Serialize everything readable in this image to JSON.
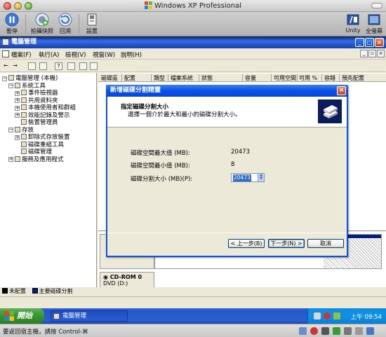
{
  "host": {
    "title": "Windows XP Professional",
    "toolbar": {
      "pause": "暫停",
      "snapshot": "拍攝快照",
      "revert": "回溯",
      "settings": "設置",
      "unity": "Unity",
      "fullscreen": "全螢幕"
    },
    "status_message": "要返回宿主機，請按 Control-⌘"
  },
  "mmc": {
    "title": "電腦管理",
    "menu": [
      "檔案(F)",
      "執行(A)",
      "檢視(V)",
      "視窗(W)",
      "說明(H)"
    ],
    "tree": [
      {
        "label": "電腦管理 (本機)",
        "level": 0,
        "expander": "minus"
      },
      {
        "label": "系統工具",
        "level": 1,
        "expander": "minus"
      },
      {
        "label": "事件檢視器",
        "level": 2,
        "expander": "plus"
      },
      {
        "label": "共用資料夾",
        "level": 2,
        "expander": "plus"
      },
      {
        "label": "本機使用者和群組",
        "level": 2,
        "expander": "plus"
      },
      {
        "label": "效能記錄及警示",
        "level": 2,
        "expander": "plus"
      },
      {
        "label": "裝置管理員",
        "level": 2,
        "expander": ""
      },
      {
        "label": "存放",
        "level": 1,
        "expander": "minus"
      },
      {
        "label": "卸除式存放裝置",
        "level": 2,
        "expander": "plus"
      },
      {
        "label": "磁碟重組工具",
        "level": 2,
        "expander": ""
      },
      {
        "label": "磁碟管理",
        "level": 2,
        "expander": ""
      },
      {
        "label": "服務及應用程式",
        "level": 1,
        "expander": "plus"
      }
    ],
    "columns": [
      "磁碟區",
      "配置",
      "類型",
      "檔案系統",
      "狀態",
      "容量",
      "可用空間",
      "可用 %",
      "容錯",
      "預先配置"
    ],
    "cdrom": {
      "name": "CD-ROM 0",
      "drive": "DVD (D:)"
    },
    "legend": {
      "unallocated": "未配置",
      "primary": "主要磁碟分割"
    }
  },
  "wizard": {
    "title": "新增磁碟分割精靈",
    "heading": "指定磁碟分割大小",
    "subheading": "選擇一個介於最大和最小的磁碟分割大小。",
    "max_label": "磁碟空間最大值 (MB):",
    "max_value": "20473",
    "min_label": "磁碟空間最小值 (MB):",
    "min_value": "8",
    "size_label": "磁碟分割大小 (MB)(P):",
    "size_value": "20473",
    "back": "< 上一步(B)",
    "next": "下一步(N) >",
    "cancel": "取消"
  },
  "taskbar": {
    "start": "開始",
    "task": "電腦管理",
    "time": "上午 09:54"
  },
  "colors": {
    "xp_blue": "#0a52e8",
    "taskbar": "#2456c6",
    "start_green": "#3a9a33"
  }
}
